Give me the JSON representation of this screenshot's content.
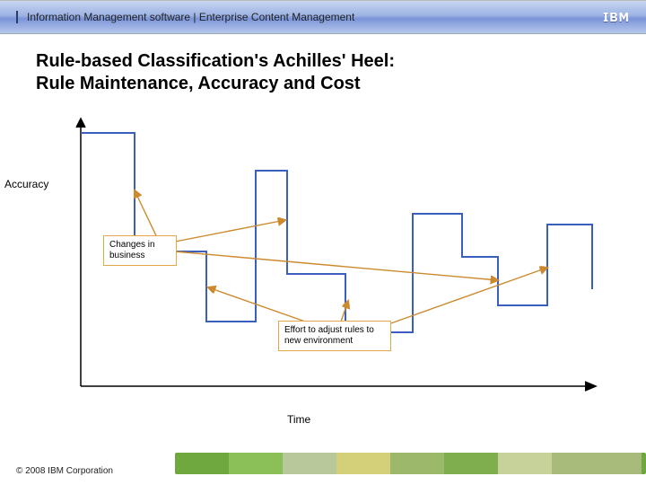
{
  "header": {
    "text": "Information Management software | Enterprise Content Management",
    "logo": "IBM"
  },
  "title_line1": "Rule-based Classification's Achilles' Heel:",
  "title_line2": "Rule Maintenance, Accuracy and Cost",
  "ylabel": "Accuracy",
  "xlabel": "Time",
  "callouts": {
    "changes": "Changes in business",
    "effort": "Effort to adjust rules to new environment"
  },
  "copyright": "© 2008 IBM Corporation",
  "chart_data": {
    "type": "line",
    "title": "Rule-based Classification's Achilles' Heel: Rule Maintenance, Accuracy and Cost",
    "xlabel": "Time",
    "ylabel": "Accuracy",
    "x": [
      0,
      10,
      10,
      22,
      22,
      30,
      30,
      36,
      36,
      46,
      46,
      58,
      58,
      67,
      67,
      74,
      74,
      84,
      84,
      94,
      94,
      100
    ],
    "y": [
      94,
      94,
      50,
      50,
      24,
      24,
      80,
      80,
      42,
      42,
      20,
      20,
      64,
      64,
      48,
      48,
      30,
      30,
      60,
      60,
      36,
      36
    ],
    "xlim": [
      0,
      100
    ],
    "ylim": [
      0,
      100
    ],
    "annotations": [
      {
        "text": "Changes in business",
        "targets": [
          [
            10,
            72
          ],
          [
            36,
            62
          ],
          [
            74,
            40
          ]
        ]
      },
      {
        "text": "Effort to adjust rules to new environment",
        "targets": [
          [
            22,
            50
          ],
          [
            46,
            40
          ],
          [
            84,
            44
          ]
        ]
      }
    ]
  }
}
